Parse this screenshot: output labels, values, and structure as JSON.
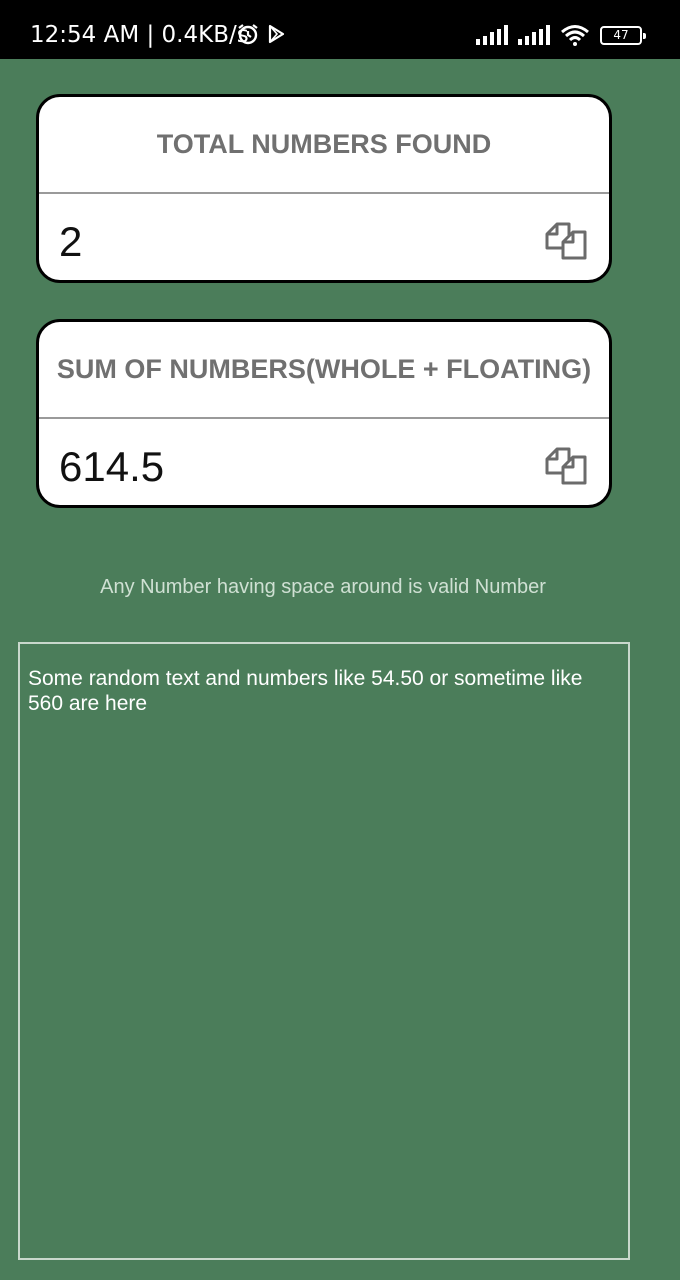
{
  "status_bar": {
    "time": "12:54 AM | 0.4KB/s",
    "battery": "47",
    "icons": [
      "alarm-icon",
      "play-store-icon",
      "signal-icon",
      "signal-icon",
      "wifi-icon",
      "battery-icon"
    ]
  },
  "cards": [
    {
      "title": "TOTAL NUMBERS FOUND",
      "value": "2",
      "copy_icon": "copy-icon"
    },
    {
      "title": "SUM OF NUMBERS(WHOLE + FLOATING)",
      "value": "614.5",
      "copy_icon": "copy-icon"
    }
  ],
  "hint": "Any Number having space around is valid Number",
  "input": {
    "value": "Some random text and numbers like 54.50 or sometime like\n560 are here"
  },
  "colors": {
    "background": "#4b7d5a",
    "card": "#ffffff",
    "card_title": "#707070"
  }
}
